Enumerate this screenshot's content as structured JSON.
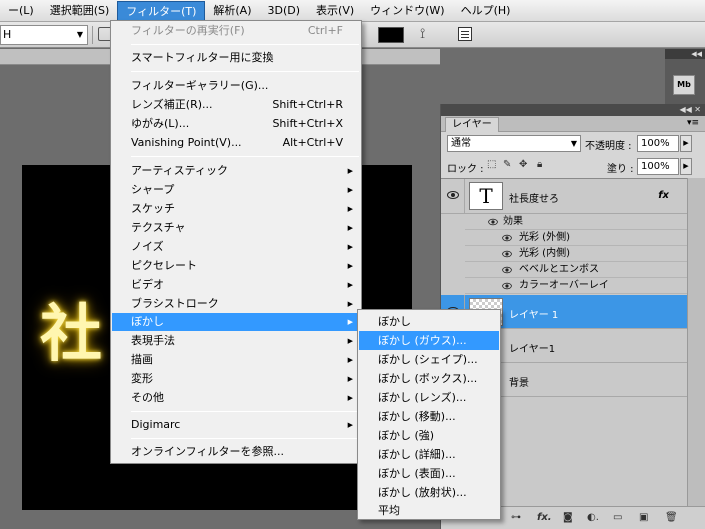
{
  "menubar": {
    "items": [
      {
        "label": "ー(L)"
      },
      {
        "label": "選択範囲(S)"
      },
      {
        "label": "フィルター(T)"
      },
      {
        "label": "解析(A)"
      },
      {
        "label": "3D(D)"
      },
      {
        "label": "表示(V)"
      },
      {
        "label": "ウィンドウ(W)"
      },
      {
        "label": "ヘルプ(H)"
      }
    ]
  },
  "options_bar": {
    "tool_preset_value": "H",
    "text_color": "#000000"
  },
  "canvas": {
    "visible_text": "社"
  },
  "filter_menu": {
    "items": [
      {
        "label": "フィルターの再実行(F)",
        "shortcut": "Ctrl+F",
        "disabled": true
      },
      {
        "label": "スマートフィルター用に変換"
      },
      {
        "label": "フィルターギャラリー(G)..."
      },
      {
        "label": "レンズ補正(R)...",
        "shortcut": "Shift+Ctrl+R"
      },
      {
        "label": "ゆがみ(L)...",
        "shortcut": "Shift+Ctrl+X"
      },
      {
        "label": "Vanishing Point(V)...",
        "shortcut": "Alt+Ctrl+V"
      },
      {
        "label": "アーティスティック"
      },
      {
        "label": "シャープ"
      },
      {
        "label": "スケッチ"
      },
      {
        "label": "テクスチャ"
      },
      {
        "label": "ノイズ"
      },
      {
        "label": "ピクセレート"
      },
      {
        "label": "ビデオ"
      },
      {
        "label": "ブラシストローク"
      },
      {
        "label": "ぼかし"
      },
      {
        "label": "表現手法"
      },
      {
        "label": "描画"
      },
      {
        "label": "変形"
      },
      {
        "label": "その他"
      },
      {
        "label": "Digimarc"
      },
      {
        "label": "オンラインフィルターを参照..."
      }
    ]
  },
  "blur_submenu": {
    "items": [
      {
        "label": "ぼかし"
      },
      {
        "label": "ぼかし (ガウス)..."
      },
      {
        "label": "ぼかし (シェイプ)..."
      },
      {
        "label": "ぼかし (ボックス)..."
      },
      {
        "label": "ぼかし (レンズ)..."
      },
      {
        "label": "ぼかし (移動)..."
      },
      {
        "label": "ぼかし (強)"
      },
      {
        "label": "ぼかし (詳細)..."
      },
      {
        "label": "ぼかし (表面)..."
      },
      {
        "label": "ぼかし (放射状)..."
      },
      {
        "label": "平均"
      }
    ]
  },
  "layers_panel": {
    "tab_label": "レイヤー",
    "blend_mode": "通常",
    "opacity_label": "不透明度 :",
    "opacity_value": "100%",
    "lock_label": "ロック :",
    "fill_label": "塗り :",
    "fill_value": "100%",
    "layers": [
      {
        "name": "社長度せろ",
        "fx": "fx"
      },
      {
        "name": "レイヤー 1"
      },
      {
        "name": "レイヤー1"
      },
      {
        "name": "背景"
      }
    ],
    "effects_label": "効果",
    "effects": [
      "光彩 (外側)",
      "光彩 (内側)",
      "ベベルとエンボス",
      "カラーオーバーレイ"
    ]
  },
  "dock": {
    "mb_label": "Mb"
  },
  "colors": {
    "menu_highlight": "#3399ff",
    "selected_layer": "#3c96e6",
    "glow": "#ffe24a"
  }
}
